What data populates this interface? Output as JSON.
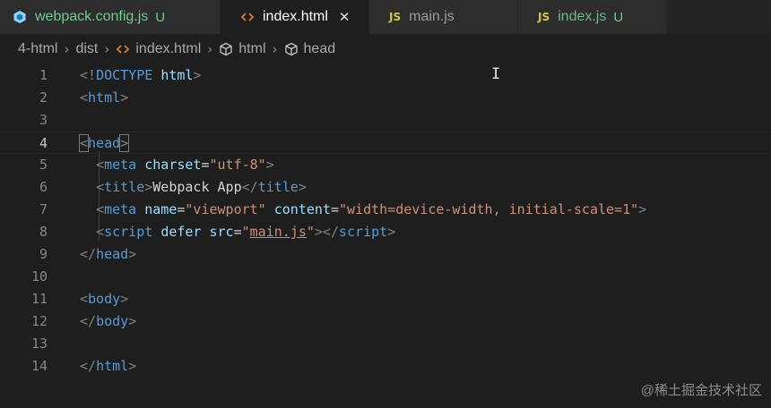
{
  "tabs": [
    {
      "label": "webpack.config.js",
      "icon": "webpack-icon",
      "status": "U",
      "active": false
    },
    {
      "label": "index.html",
      "icon": "html-file-icon",
      "active": true,
      "close": "✕"
    },
    {
      "label": "main.js",
      "icon": "js-file-icon",
      "icon_text": "JS",
      "active": false
    },
    {
      "label": "index.js",
      "icon": "js-file-icon",
      "icon_text": "JS",
      "status": "U",
      "active": false
    }
  ],
  "breadcrumb": {
    "items": [
      "4-html",
      "dist",
      "index.html",
      "html",
      "head"
    ],
    "separator": "›"
  },
  "editor": {
    "current_line": 4,
    "lines": [
      {
        "n": "1",
        "tokens": [
          [
            "bracket",
            "<!"
          ],
          [
            "tag",
            "DOCTYPE"
          ],
          [
            "text",
            " "
          ],
          [
            "attr",
            "html"
          ],
          [
            "bracket",
            ">"
          ]
        ]
      },
      {
        "n": "2",
        "tokens": [
          [
            "bracket",
            "<"
          ],
          [
            "tag",
            "html"
          ],
          [
            "bracket",
            ">"
          ]
        ]
      },
      {
        "n": "3",
        "tokens": []
      },
      {
        "n": "4",
        "tokens": [
          [
            "bracket-match",
            "<"
          ],
          [
            "tag",
            "head"
          ],
          [
            "bracket-match",
            ">"
          ]
        ]
      },
      {
        "n": "5",
        "tokens": [
          [
            "text",
            "  "
          ],
          [
            "bracket",
            "<"
          ],
          [
            "tag",
            "meta"
          ],
          [
            "text",
            " "
          ],
          [
            "attr",
            "charset"
          ],
          [
            "text",
            "="
          ],
          [
            "str",
            "\"utf-8\""
          ],
          [
            "bracket",
            ">"
          ]
        ]
      },
      {
        "n": "6",
        "tokens": [
          [
            "text",
            "  "
          ],
          [
            "bracket",
            "<"
          ],
          [
            "tag",
            "title"
          ],
          [
            "bracket",
            ">"
          ],
          [
            "text",
            "Webpack App"
          ],
          [
            "bracket",
            "</"
          ],
          [
            "tag",
            "title"
          ],
          [
            "bracket",
            ">"
          ]
        ]
      },
      {
        "n": "7",
        "tokens": [
          [
            "text",
            "  "
          ],
          [
            "bracket",
            "<"
          ],
          [
            "tag",
            "meta"
          ],
          [
            "text",
            " "
          ],
          [
            "attr",
            "name"
          ],
          [
            "text",
            "="
          ],
          [
            "str",
            "\"viewport\""
          ],
          [
            "text",
            " "
          ],
          [
            "attr",
            "content"
          ],
          [
            "text",
            "="
          ],
          [
            "str",
            "\"width=device-width, initial-scale=1\""
          ],
          [
            "bracket",
            ">"
          ]
        ]
      },
      {
        "n": "8",
        "tokens": [
          [
            "text",
            "  "
          ],
          [
            "bracket",
            "<"
          ],
          [
            "tag",
            "script"
          ],
          [
            "text",
            " "
          ],
          [
            "attr",
            "defer"
          ],
          [
            "text",
            " "
          ],
          [
            "attr",
            "src"
          ],
          [
            "text",
            "="
          ],
          [
            "str",
            "\""
          ],
          [
            "link",
            "main.js"
          ],
          [
            "str",
            "\""
          ],
          [
            "bracket",
            "></"
          ],
          [
            "tag",
            "script"
          ],
          [
            "bracket",
            ">"
          ]
        ]
      },
      {
        "n": "9",
        "tokens": [
          [
            "bracket",
            "</"
          ],
          [
            "tag",
            "head"
          ],
          [
            "bracket",
            ">"
          ]
        ]
      },
      {
        "n": "10",
        "tokens": []
      },
      {
        "n": "11",
        "tokens": [
          [
            "bracket",
            "<"
          ],
          [
            "tag",
            "body"
          ],
          [
            "bracket",
            ">"
          ]
        ]
      },
      {
        "n": "12",
        "tokens": [
          [
            "bracket",
            "</"
          ],
          [
            "tag",
            "body"
          ],
          [
            "bracket",
            ">"
          ]
        ]
      },
      {
        "n": "13",
        "tokens": []
      },
      {
        "n": "14",
        "tokens": [
          [
            "bracket",
            "</"
          ],
          [
            "tag",
            "html"
          ],
          [
            "bracket",
            ">"
          ]
        ]
      }
    ]
  },
  "mouse_cursor": "I",
  "watermark": "@稀土掘金技术社区",
  "colors": {
    "background": "#1e1e1e",
    "tag": "#569cd6",
    "attribute": "#9cdcfe",
    "string": "#ce9178",
    "untracked": "#73c991",
    "js_badge": "#cbcb41",
    "html_icon": "#e37933",
    "webpack_icon": "#8ed6fb"
  }
}
